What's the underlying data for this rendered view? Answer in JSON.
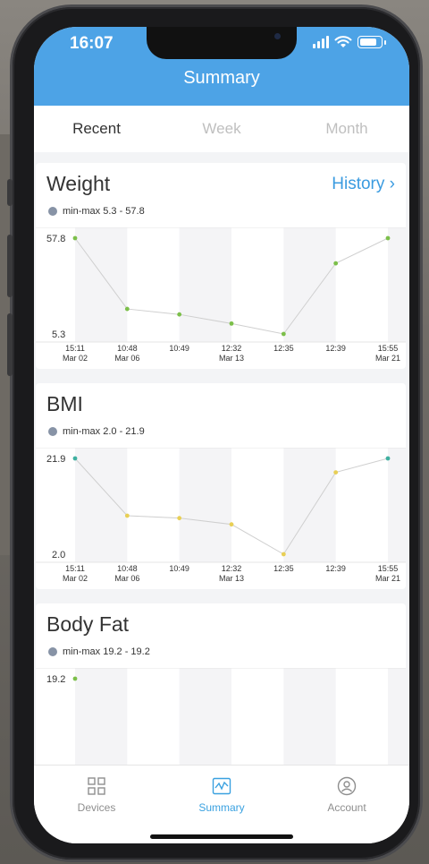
{
  "status": {
    "time": "16:07"
  },
  "header": {
    "title": "Summary"
  },
  "tabs": [
    {
      "label": "Recent"
    },
    {
      "label": "Week"
    },
    {
      "label": "Month"
    }
  ],
  "colors": {
    "header": "#4da3e6",
    "accent": "#3a9be0",
    "green": "#7cbf4a",
    "yellow": "#e8cf55",
    "teal": "#3fb0a0"
  },
  "cards": {
    "weight": {
      "title": "Weight",
      "history": "History",
      "legend": "min-max 5.3 - 57.8",
      "ymax_label": "57.8",
      "ymin_label": "5.3",
      "chart_data": {
        "type": "line",
        "x": [
          "15:11 Mar 02",
          "10:48 Mar 06",
          "10:49",
          "12:32 Mar 13",
          "12:35",
          "12:39",
          "15:55 Mar 21"
        ],
        "values": [
          57.8,
          19.0,
          16.0,
          11.0,
          5.3,
          44.0,
          57.8
        ],
        "ylim": [
          5.3,
          57.8
        ]
      }
    },
    "bmi": {
      "title": "BMI",
      "legend": "min-max 2.0 - 21.9",
      "ymax_label": "21.9",
      "ymin_label": "2.0",
      "chart_data": {
        "type": "line",
        "x": [
          "15:11 Mar 02",
          "10:48 Mar 06",
          "10:49",
          "12:32 Mar 13",
          "12:35",
          "12:39",
          "15:55 Mar 21"
        ],
        "values": [
          21.9,
          10.0,
          9.5,
          8.2,
          2.0,
          19.0,
          21.9
        ],
        "ylim": [
          2.0,
          21.9
        ]
      }
    },
    "bodyfat": {
      "title": "Body Fat",
      "legend": "min-max 19.2 - 19.2",
      "ymax_label": "19.2",
      "chart_data": {
        "type": "scatter",
        "x": [
          "15:11 Mar 02"
        ],
        "values": [
          19.2
        ]
      }
    }
  },
  "x_ticks": [
    {
      "time": "15:11",
      "date": "Mar 02"
    },
    {
      "time": "10:48",
      "date": "Mar 06"
    },
    {
      "time": "10:49",
      "date": ""
    },
    {
      "time": "12:32",
      "date": "Mar 13"
    },
    {
      "time": "12:35",
      "date": ""
    },
    {
      "time": "12:39",
      "date": ""
    },
    {
      "time": "15:55",
      "date": "Mar 21"
    }
  ],
  "tabbar": [
    {
      "label": "Devices",
      "icon": "devices-icon"
    },
    {
      "label": "Summary",
      "icon": "summary-icon"
    },
    {
      "label": "Account",
      "icon": "account-icon"
    }
  ]
}
